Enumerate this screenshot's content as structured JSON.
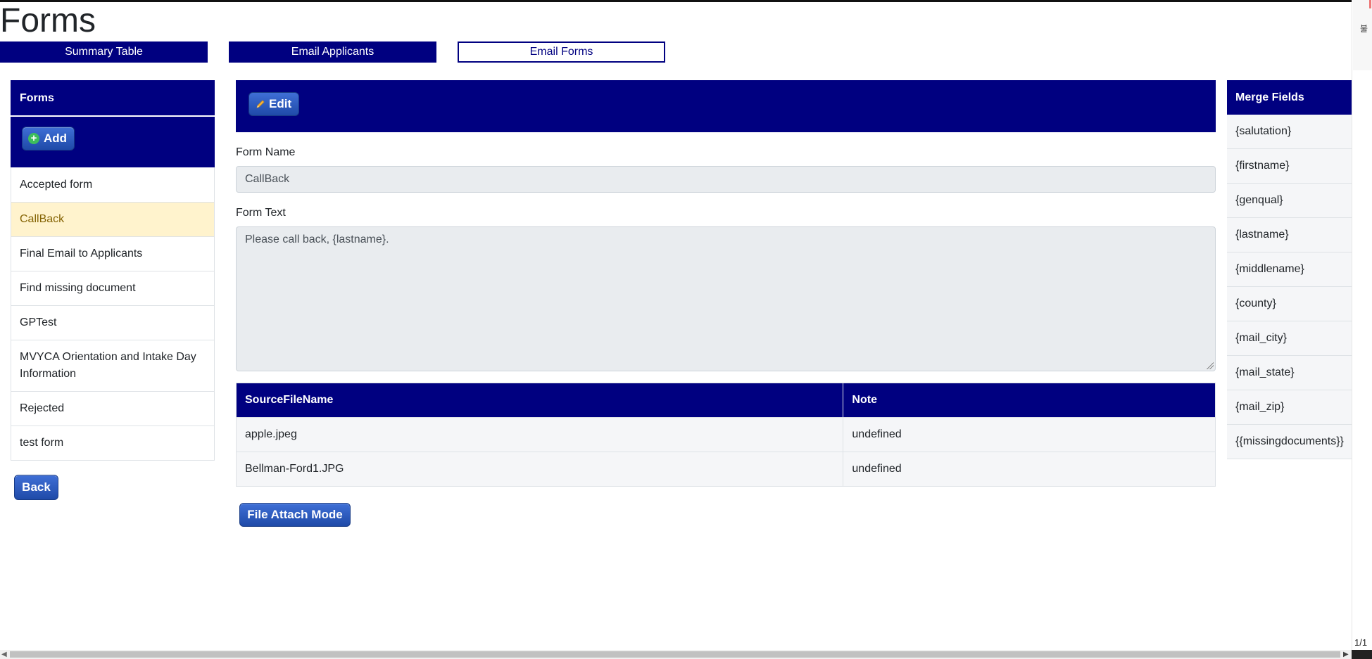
{
  "page": {
    "title": "Forms"
  },
  "tabs": [
    {
      "label": "Summary Table"
    },
    {
      "label": "Email Applicants"
    },
    {
      "label": "Email Forms"
    }
  ],
  "sidebar": {
    "header": "Forms",
    "add_label": "Add",
    "items": [
      {
        "label": "Accepted form"
      },
      {
        "label": "CallBack"
      },
      {
        "label": "Final Email to Applicants"
      },
      {
        "label": "Find missing document"
      },
      {
        "label": "GPTest"
      },
      {
        "label": "MVYCA Orientation and Intake Day Information"
      },
      {
        "label": "Rejected"
      },
      {
        "label": "test form"
      }
    ],
    "selected": "CallBack",
    "back_label": "Back"
  },
  "main": {
    "edit_label": "Edit",
    "form_name_label": "Form Name",
    "form_name_value": "CallBack",
    "form_text_label": "Form Text",
    "form_text_value": "Please call back, {lastname}.",
    "table": {
      "columns": [
        "SourceFileName",
        "Note"
      ],
      "rows": [
        [
          "apple.jpeg",
          "undefined"
        ],
        [
          "Bellman-Ford1.JPG",
          "undefined"
        ]
      ]
    },
    "attach_label": "File Attach Mode"
  },
  "merge_fields": {
    "header": "Merge Fields",
    "items": [
      "{salutation}",
      "{firstname}",
      "{genqual}",
      "{lastname}",
      "{middlename}",
      "{county}",
      "{mail_city}",
      "{mail_state}",
      "{mail_zip}",
      "{{missingdocuments}}"
    ]
  },
  "browser": {
    "page_indicator": "1/1",
    "side_glyph": "불"
  },
  "colors": {
    "brand": "#000080",
    "selected_bg": "#fff3cd",
    "button": "#1f4aa8"
  },
  "icons": [
    "plus-icon",
    "pencil-icon"
  ]
}
